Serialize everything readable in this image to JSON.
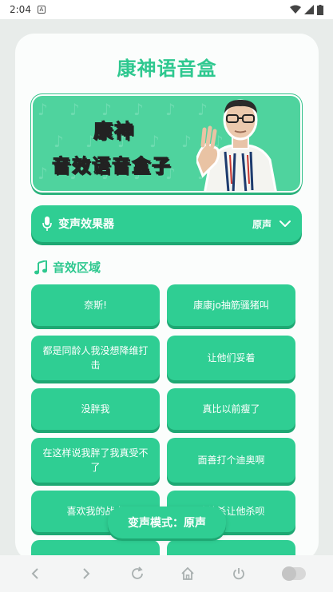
{
  "status_bar": {
    "time": "2:04",
    "notification": "A"
  },
  "app": {
    "title": "康神语音盒"
  },
  "banner": {
    "line1": "康神",
    "line2": "音效语音盒子"
  },
  "voice_changer": {
    "label": "变声效果器",
    "value": "原声"
  },
  "section": {
    "title": "音效区域"
  },
  "sound_buttons": [
    "奈斯!",
    "康康jo抽筋骚猪叫",
    "都是同龄人我没想降维打击",
    "让他们妥着",
    "没胖我",
    "真比以前瘦了",
    "在这样说我胖了我真受不了",
    "面善打个迪奥啊",
    "喜欢我的战术",
    "让他杀让他杀呗",
    "",
    ""
  ],
  "toast": {
    "text": "变声模式：原声"
  },
  "colors": {
    "accent": "#2fce93",
    "accent_dark": "#1ea873",
    "title": "#2ec88f",
    "card": "#fbfdfc",
    "background": "#e8ecea"
  }
}
